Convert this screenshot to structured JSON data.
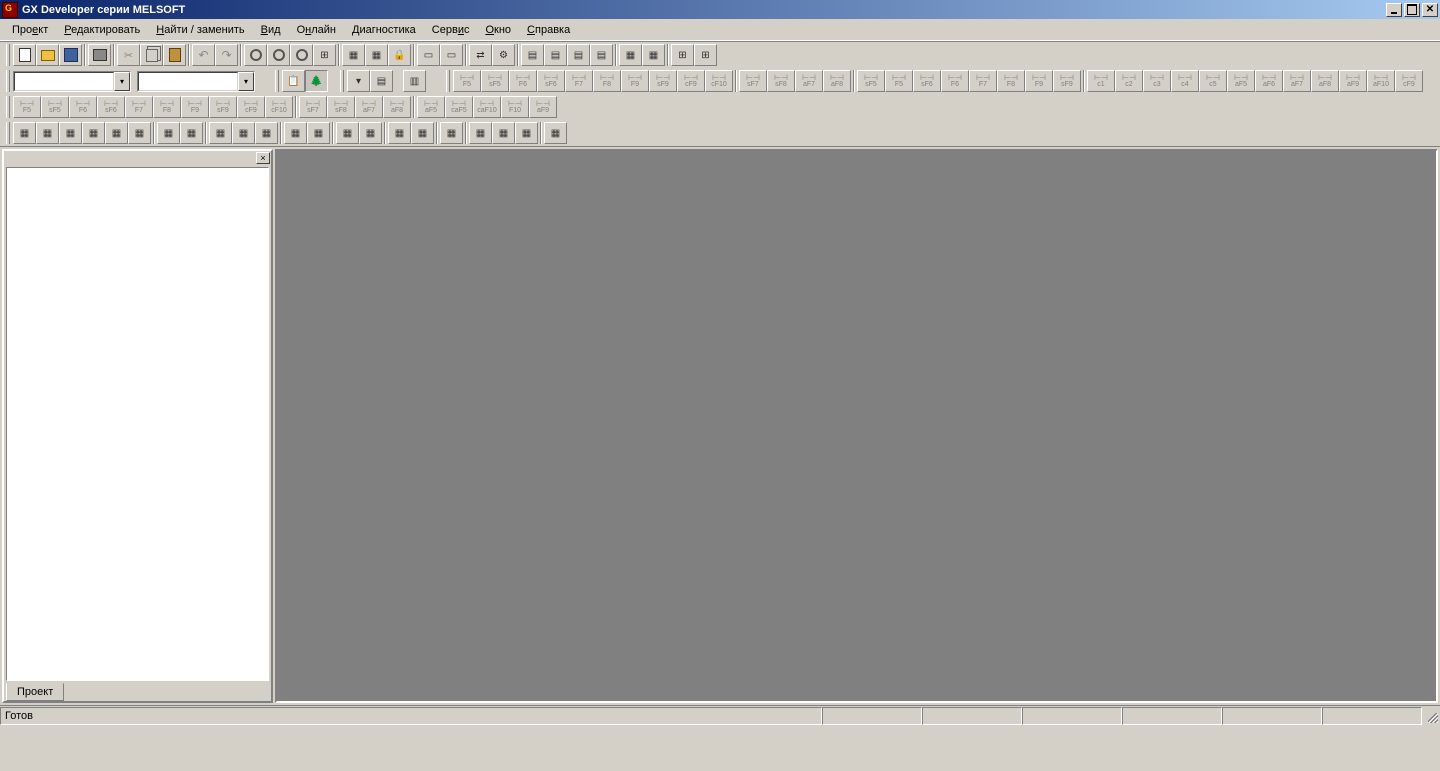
{
  "title": "GX Developer серии MELSOFT",
  "menu": {
    "project": "Проект",
    "edit": "Редактировать",
    "find": "Найти / заменить",
    "view": "Вид",
    "online": "Онлайн",
    "diagnostics": "Диагностика",
    "service": "Сервис",
    "window": "Окно",
    "help": "Справка"
  },
  "toolbar1": {
    "new": "new",
    "open": "open",
    "save": "save",
    "print": "print",
    "cut": "cut",
    "copy": "copy",
    "paste": "paste",
    "undo": "undo",
    "redo": "redo"
  },
  "ladder_keys": {
    "r2": [
      "F5",
      "sF5",
      "F6",
      "sF6",
      "F7",
      "F8",
      "F9",
      "sF9",
      "cF9",
      "cF10",
      "sF7",
      "sF8",
      "aF7",
      "aF8",
      "sF5",
      "F5",
      "sF6",
      "F6",
      "F7",
      "F8",
      "F9",
      "sF9",
      "c1",
      "c2",
      "c3",
      "c4",
      "c5",
      "aF5",
      "aF6",
      "aF7",
      "aF8",
      "aF9",
      "aF10",
      "cF9"
    ],
    "r3": [
      "F5",
      "sF5",
      "F6",
      "sF6",
      "F7",
      "F8",
      "F9",
      "sF9",
      "cF9",
      "cF10",
      "sF7",
      "sF8",
      "aF7",
      "aF8",
      "aF5",
      "caF5",
      "caF10",
      "F10",
      "aF9"
    ]
  },
  "sidebar": {
    "tab_project": "Проект"
  },
  "status": {
    "ready": "Готов"
  }
}
